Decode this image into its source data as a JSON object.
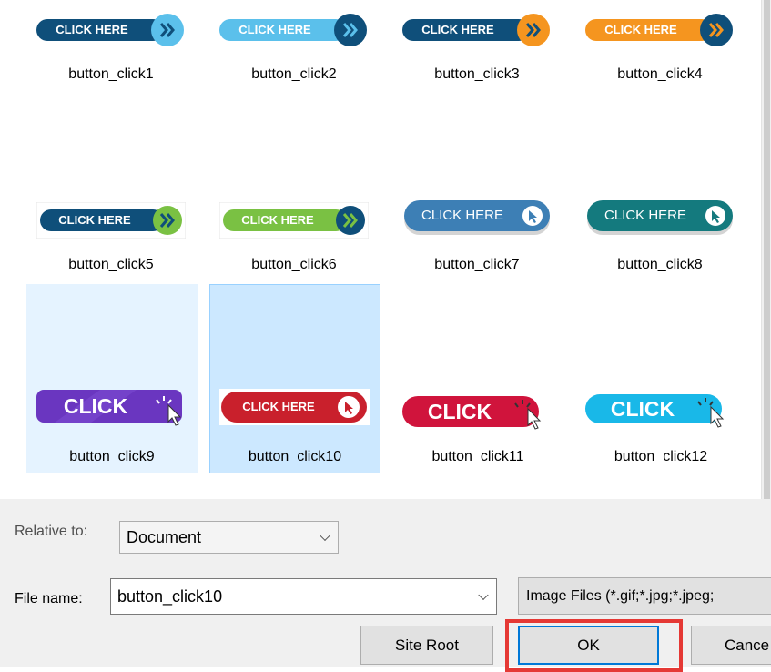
{
  "files": [
    {
      "name": "button_click1",
      "button_text": "CLICK HERE"
    },
    {
      "name": "button_click2",
      "button_text": "CLICK HERE"
    },
    {
      "name": "button_click3",
      "button_text": "CLICK HERE"
    },
    {
      "name": "button_click4",
      "button_text": "CLICK HERE"
    },
    {
      "name": "button_click5",
      "button_text": "CLICK HERE"
    },
    {
      "name": "button_click6",
      "button_text": "CLICK HERE"
    },
    {
      "name": "button_click7",
      "button_text": "CLICK HERE"
    },
    {
      "name": "button_click8",
      "button_text": "CLICK HERE"
    },
    {
      "name": "button_click9",
      "button_text": "CLICK"
    },
    {
      "name": "button_click10",
      "button_text": "CLICK HERE"
    },
    {
      "name": "button_click11",
      "button_text": "CLICK"
    },
    {
      "name": "button_click12",
      "button_text": "CLICK"
    }
  ],
  "colors": {
    "navy": "#0f4f7a",
    "sky": "#5bc0eb",
    "orange": "#f5951f",
    "green": "#7ac143",
    "steel": "#3d7fb5",
    "teal": "#147a7e",
    "purple": "#6a36c0",
    "red": "#c9202c",
    "crimson": "#d0143c",
    "cyan": "#19b8e8",
    "selection": "#cce8ff",
    "highlight": "#e53935"
  },
  "footer": {
    "relative_label": "Relative to:",
    "relative_value": "Document",
    "filename_label": "File name:",
    "filename_value": "button_click10",
    "filetype_text": "Image Files (*.gif;*.jpg;*.jpeg;",
    "site_root_label": "Site Root",
    "ok_label": "OK",
    "cancel_label": "Cance"
  }
}
